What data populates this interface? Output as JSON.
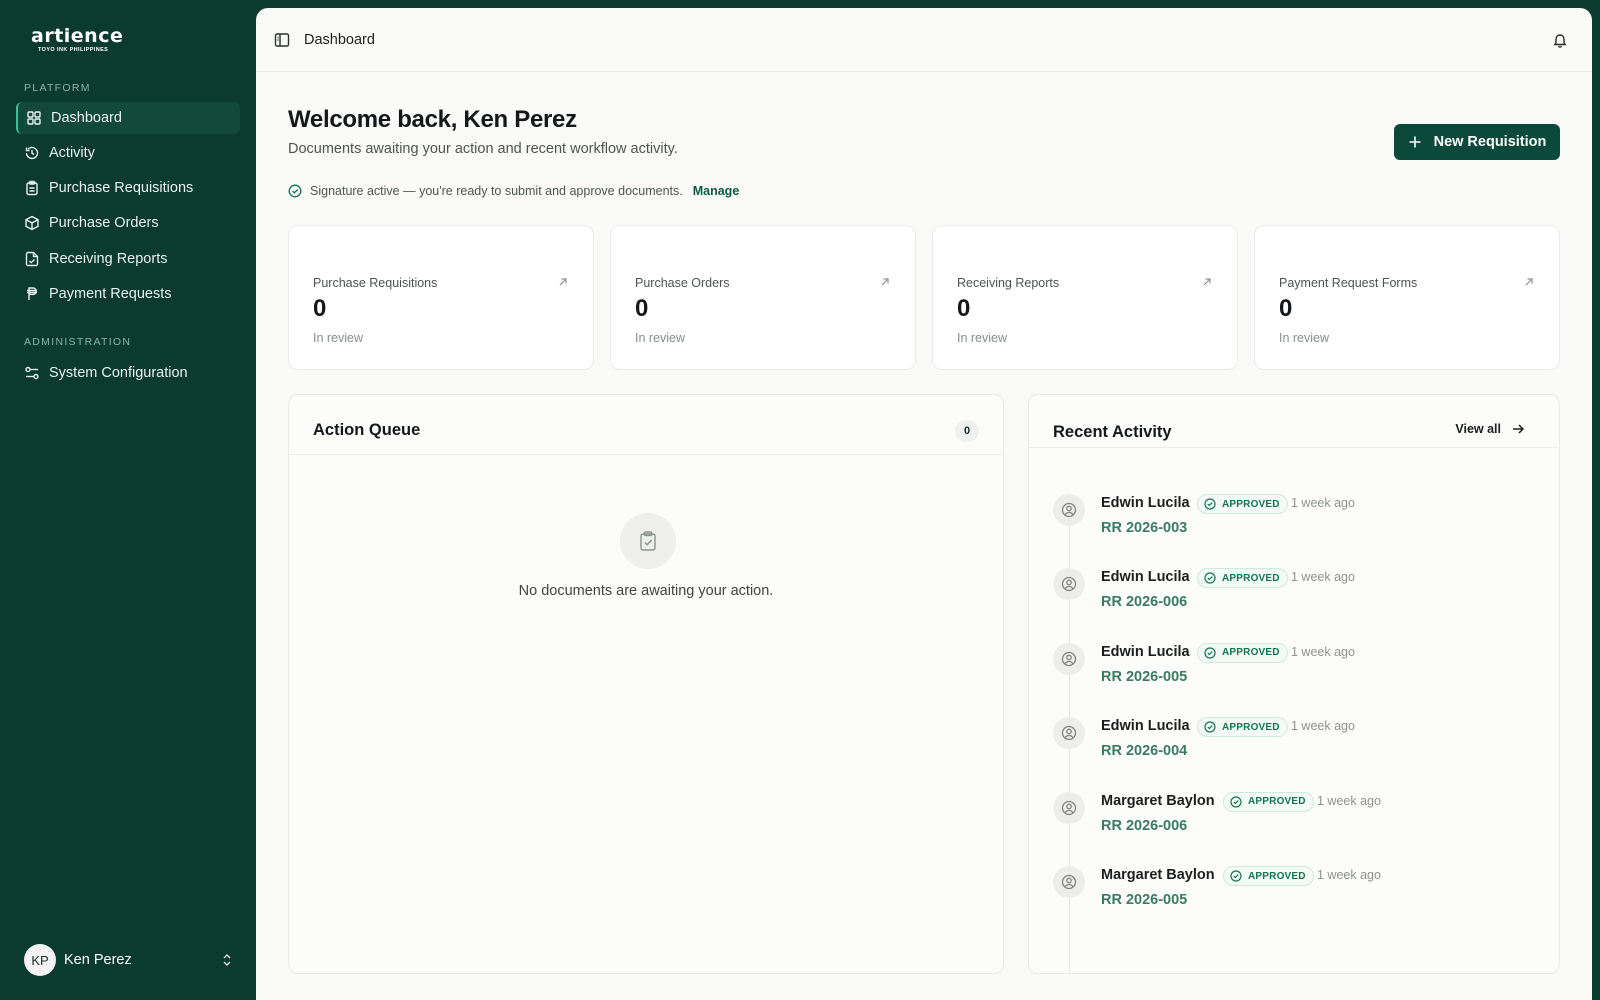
{
  "brand": {
    "logo_word": "artience",
    "logo_sub": "TOYO INK PHILIPPINES"
  },
  "sidebar": {
    "sections": [
      {
        "label": "PLATFORM"
      },
      {
        "label": "ADMINISTRATION"
      }
    ],
    "items": [
      {
        "label": "Dashboard",
        "icon": "dashboard-icon",
        "active": true
      },
      {
        "label": "Activity",
        "icon": "history-icon"
      },
      {
        "label": "Purchase Requisitions",
        "icon": "clipboard-icon"
      },
      {
        "label": "Purchase Orders",
        "icon": "package-icon"
      },
      {
        "label": "Receiving Reports",
        "icon": "file-check-icon"
      },
      {
        "label": "Payment Requests",
        "icon": "peso-icon"
      },
      {
        "label": "System Configuration",
        "icon": "settings-sliders-icon"
      }
    ],
    "user": {
      "initials": "KP",
      "name": "Ken Perez"
    }
  },
  "topbar": {
    "title": "Dashboard"
  },
  "header": {
    "welcome": "Welcome back, Ken Perez",
    "subtitle": "Documents awaiting your action and recent workflow activity.",
    "new_button": "New Requisition",
    "signature_text": "Signature active — you're ready to submit and approve documents.",
    "signature_link": "Manage"
  },
  "stats": [
    {
      "label": "Purchase Requisitions",
      "value": "0",
      "foot": "In review"
    },
    {
      "label": "Purchase Orders",
      "value": "0",
      "foot": "In review"
    },
    {
      "label": "Receiving Reports",
      "value": "0",
      "foot": "In review"
    },
    {
      "label": "Payment Request Forms",
      "value": "0",
      "foot": "In review"
    }
  ],
  "queue": {
    "title": "Action Queue",
    "count": "0",
    "empty": "No documents are awaiting your action."
  },
  "activity": {
    "title": "Recent Activity",
    "view_all": "View all",
    "items": [
      {
        "name": "Edwin Lucila",
        "status": "APPROVED",
        "time": "1 week ago",
        "doc": "RR 2026-003"
      },
      {
        "name": "Edwin Lucila",
        "status": "APPROVED",
        "time": "1 week ago",
        "doc": "RR 2026-006"
      },
      {
        "name": "Edwin Lucila",
        "status": "APPROVED",
        "time": "1 week ago",
        "doc": "RR 2026-005"
      },
      {
        "name": "Edwin Lucila",
        "status": "APPROVED",
        "time": "1 week ago",
        "doc": "RR 2026-004"
      },
      {
        "name": "Margaret Baylon",
        "status": "APPROVED",
        "time": "1 week ago",
        "doc": "RR 2026-006"
      },
      {
        "name": "Margaret Baylon",
        "status": "APPROVED",
        "time": "1 week ago",
        "doc": "RR 2026-005"
      }
    ]
  },
  "colors": {
    "sidebar_bg": "#0b3a2e",
    "accent": "#0b4a3a",
    "approved_text": "#157453",
    "doc_link": "#3b7a63"
  }
}
